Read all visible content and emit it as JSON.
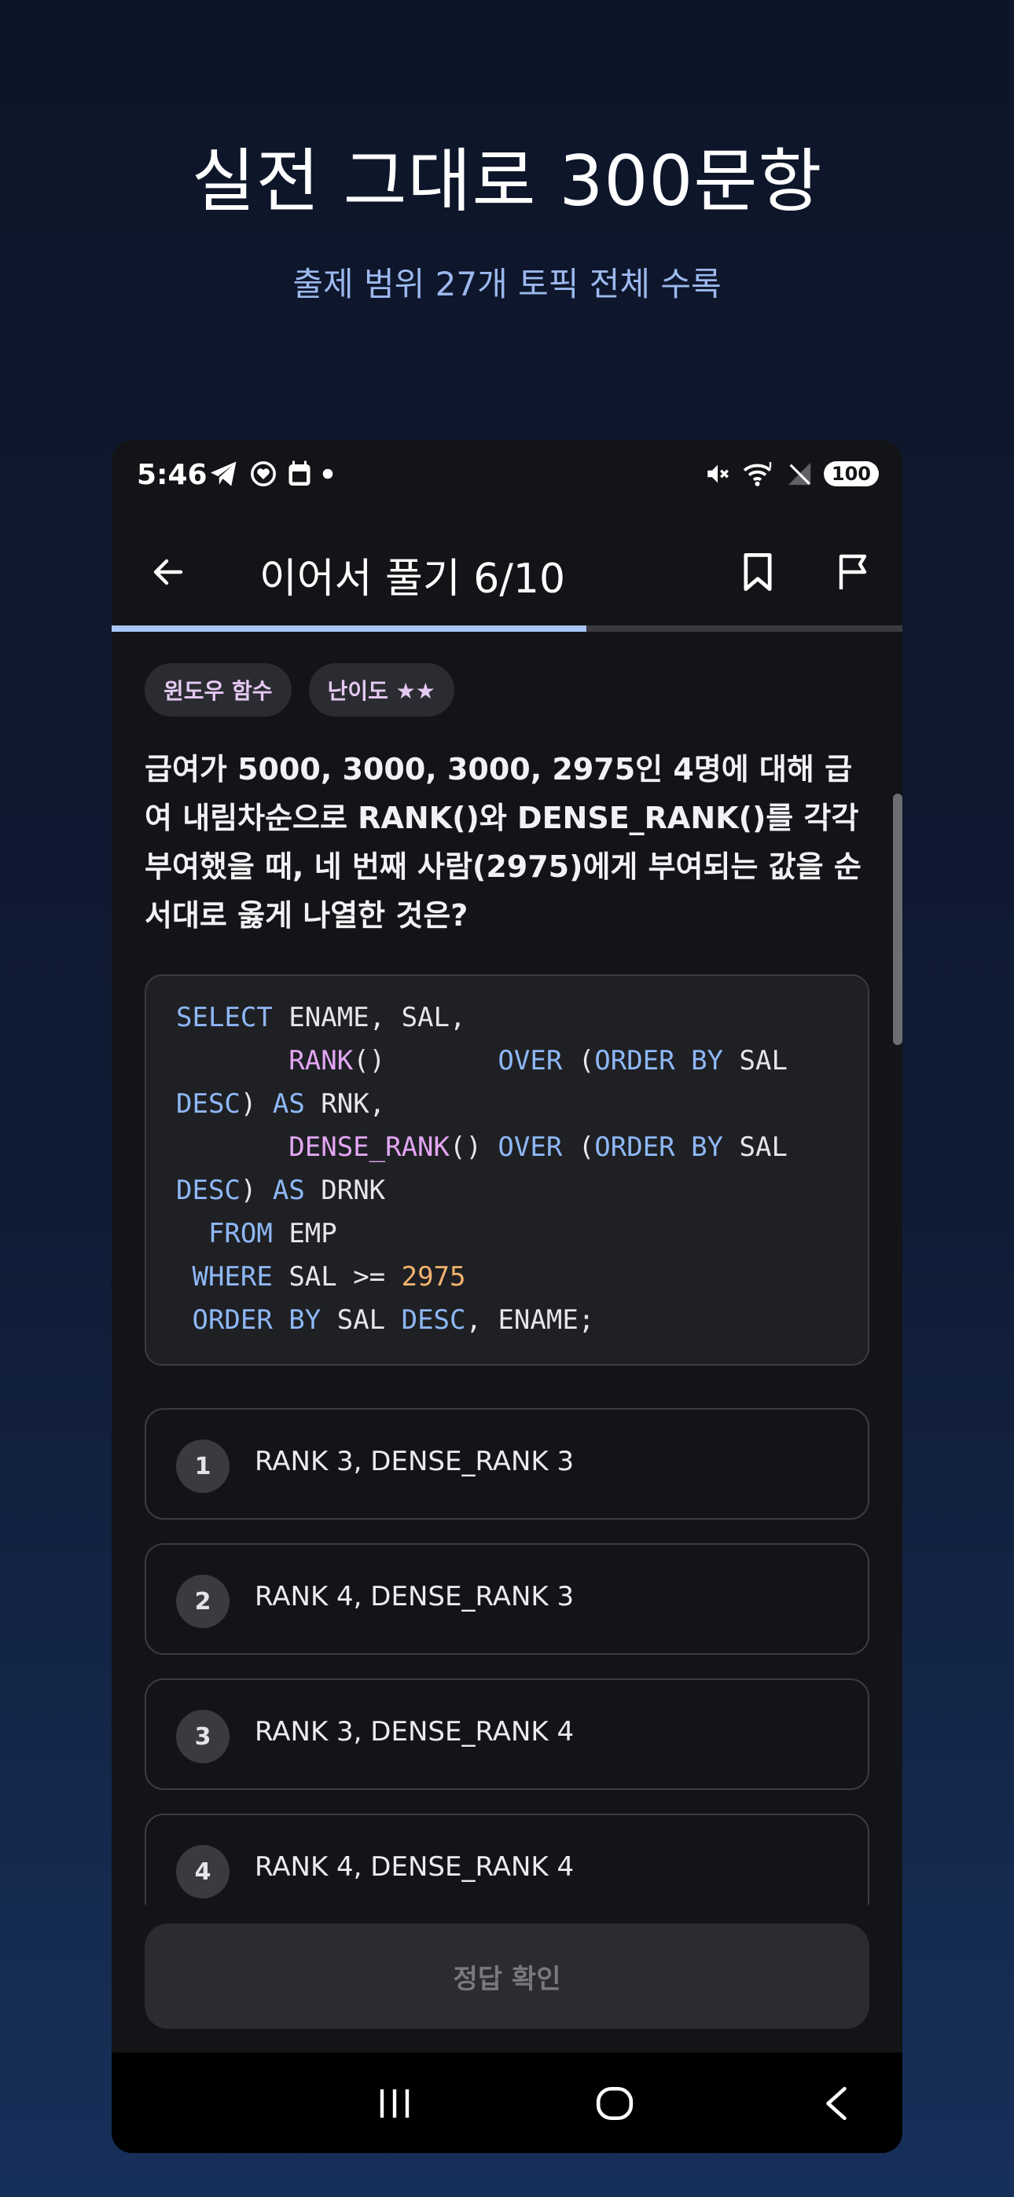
{
  "promo": {
    "title": "실전 그대로 300문항",
    "subtitle": "출제 범위 27개 토픽 전체 수록"
  },
  "status_bar": {
    "time": "5:46",
    "battery": "100",
    "left_icons": [
      "telegram-icon",
      "heart-circle-icon",
      "calendar-icon",
      "dot-icon"
    ],
    "right_icons": [
      "mute-icon",
      "wifi-icon",
      "no-signal-icon",
      "battery-icon"
    ]
  },
  "app_bar": {
    "title": "이어서 풀기  6/10",
    "progress": 0.6
  },
  "question": {
    "tags": [
      "윈도우 함수",
      "난이도 ★★"
    ],
    "text": "급여가 5000, 3000, 3000, 2975인 4명에 대해 급여 내림차순으로 RANK()와 DENSE_RANK()를 각각 부여했을 때, 네 번째 사람(2975)에게 부여되는 값을 순서대로 옳게 나열한 것은?",
    "code": [
      [
        {
          "t": "SELECT",
          "c": "kw"
        },
        {
          "t": " ENAME, SAL,",
          "c": ""
        }
      ],
      [
        {
          "t": "       ",
          "c": ""
        },
        {
          "t": "RANK",
          "c": "fn"
        },
        {
          "t": "()       ",
          "c": ""
        },
        {
          "t": "OVER",
          "c": "kw"
        },
        {
          "t": " (",
          "c": ""
        },
        {
          "t": "ORDER BY",
          "c": "kw"
        },
        {
          "t": " SAL",
          "c": ""
        }
      ],
      [
        {
          "t": "DESC",
          "c": "kw"
        },
        {
          "t": ") ",
          "c": ""
        },
        {
          "t": "AS",
          "c": "kw"
        },
        {
          "t": " RNK,",
          "c": ""
        }
      ],
      [
        {
          "t": "       ",
          "c": ""
        },
        {
          "t": "DENSE_RANK",
          "c": "fn"
        },
        {
          "t": "() ",
          "c": ""
        },
        {
          "t": "OVER",
          "c": "kw"
        },
        {
          "t": " (",
          "c": ""
        },
        {
          "t": "ORDER BY",
          "c": "kw"
        },
        {
          "t": " SAL",
          "c": ""
        }
      ],
      [
        {
          "t": "DESC",
          "c": "kw"
        },
        {
          "t": ") ",
          "c": ""
        },
        {
          "t": "AS",
          "c": "kw"
        },
        {
          "t": " DRNK",
          "c": ""
        }
      ],
      [
        {
          "t": "  ",
          "c": ""
        },
        {
          "t": "FROM",
          "c": "kw"
        },
        {
          "t": " EMP",
          "c": ""
        }
      ],
      [
        {
          "t": " ",
          "c": ""
        },
        {
          "t": "WHERE",
          "c": "kw"
        },
        {
          "t": " SAL >= ",
          "c": ""
        },
        {
          "t": "2975",
          "c": "num"
        }
      ],
      [
        {
          "t": " ",
          "c": ""
        },
        {
          "t": "ORDER BY",
          "c": "kw"
        },
        {
          "t": " SAL ",
          "c": ""
        },
        {
          "t": "DESC",
          "c": "kw"
        },
        {
          "t": ", ENAME;",
          "c": ""
        }
      ]
    ],
    "options": [
      {
        "num": "1",
        "text": "RANK 3, DENSE_RANK 3"
      },
      {
        "num": "2",
        "text": "RANK 4, DENSE_RANK 3"
      },
      {
        "num": "3",
        "text": "RANK 3, DENSE_RANK 4"
      },
      {
        "num": "4",
        "text": "RANK 4, DENSE_RANK 4"
      }
    ]
  },
  "confirm_label": "정답 확인",
  "colors": {
    "keyword": "#8eb8f6",
    "function": "#e3a6f3",
    "number": "#f2b26e",
    "progress": "#a9c6f5"
  }
}
